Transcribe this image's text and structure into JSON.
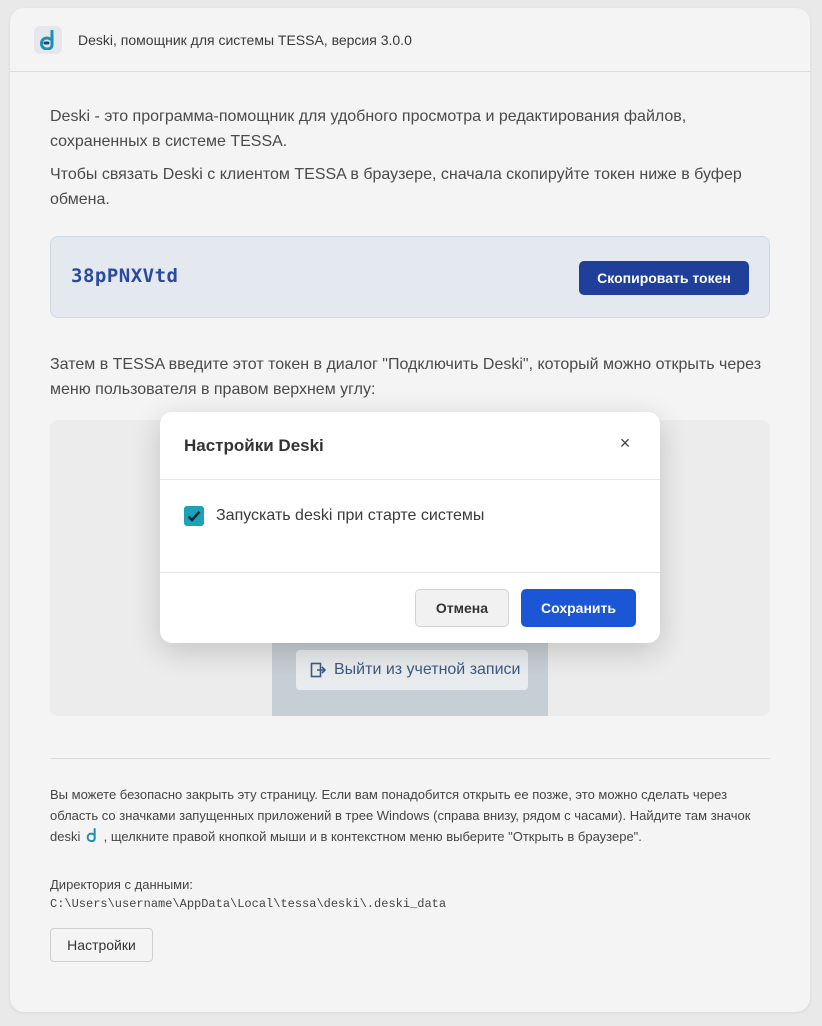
{
  "window": {
    "title": "Deski, помощник для системы TESSA, версия 3.0.0",
    "logo_icon": "deski-logo-icon"
  },
  "intro": {
    "paragraph1": "Deski - это программа-помощник для удобного просмотра и редактирования файлов, сохраненных в системе TESSA.",
    "paragraph2": "Чтобы связать Deski с клиентом TESSA в браузере, сначала скопируйте токен ниже в буфер обмена."
  },
  "token": {
    "value": "38pPNXVtd",
    "copy_label": "Скопировать токен"
  },
  "instructions": {
    "paragraph": "Затем в TESSA введите этот токен в диалог \"Подключить Deski\", который можно открыть через меню пользователя в правом верхнем углу:"
  },
  "illustration": {
    "menu_item_label": "Выйти из учетной записи"
  },
  "footer": {
    "text_before_icon": "Вы можете безопасно закрыть эту страницу. Если вам понадобится открыть ее позже, это можно сделать через область со значками запущенных приложений в трее Windows (справа внизу, рядом с часами). Найдите там значок deski",
    "text_after_icon": ", щелкните правой кнопкой мыши и в контекстном меню выберите \"Открыть в браузере\".",
    "data_dir_label": "Директория с данными:",
    "data_dir_path": "C:\\Users\\username\\AppData\\Local\\tessa\\deski\\.deski_data",
    "settings_label": "Настройки"
  },
  "modal": {
    "title": "Настройки Deski",
    "close_symbol": "×",
    "checkbox_label": "Запускать deski при старте системы",
    "checkbox_checked": true,
    "cancel_label": "Отмена",
    "save_label": "Сохранить"
  },
  "colors": {
    "accent": "#1a56d6",
    "token_button": "#1f3f9a",
    "checkbox": "#1ba3b5"
  }
}
